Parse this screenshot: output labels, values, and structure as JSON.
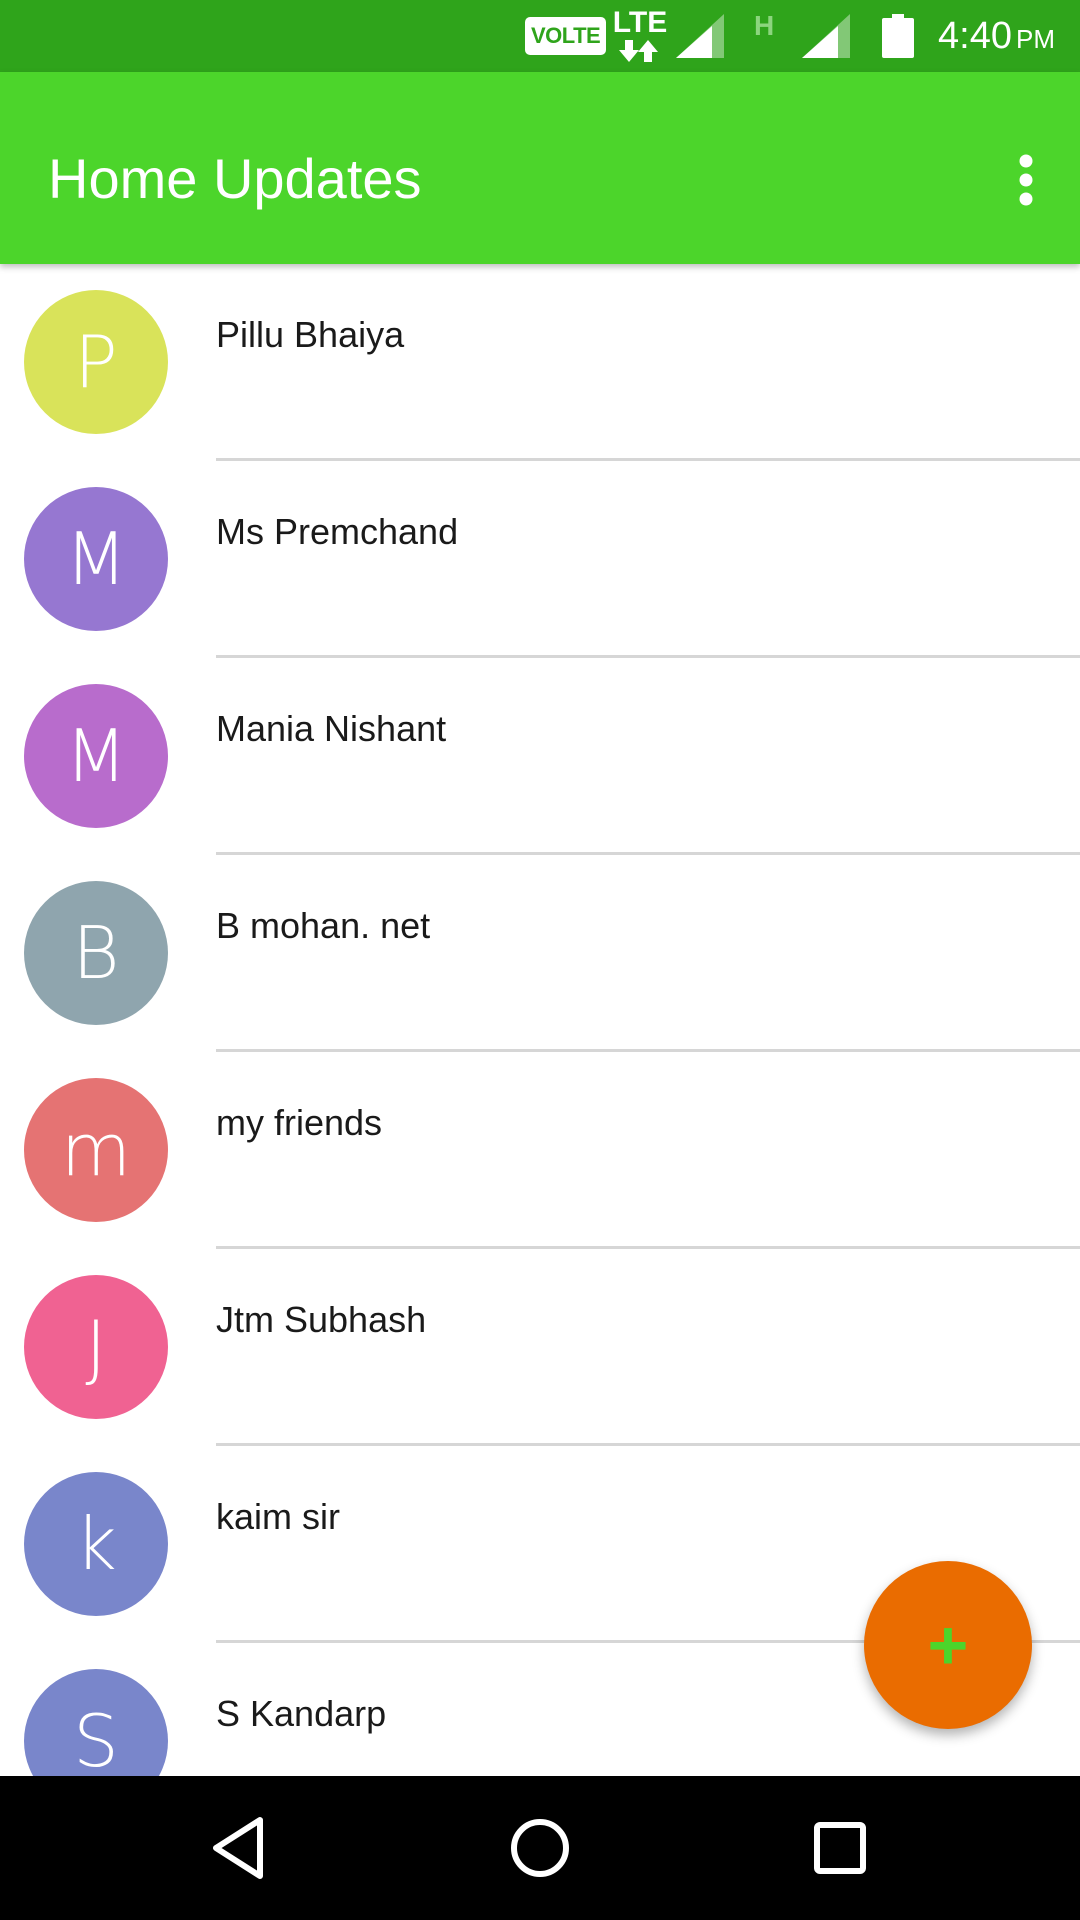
{
  "status_bar": {
    "volte": "VOLTE",
    "lte": "LTE",
    "h_indicator": "H",
    "time": "4:40",
    "ampm": "PM",
    "icons": [
      "lte-arrows-icon",
      "signal-icon",
      "signal-icon",
      "battery-icon"
    ]
  },
  "app_bar": {
    "title": "Home Updates",
    "overflow_icon": "more-vert-icon"
  },
  "contacts": [
    {
      "initial": "P",
      "name": "Pillu Bhaiya",
      "color": "#d9e35a"
    },
    {
      "initial": "M",
      "name": "Ms Premchand",
      "color": "#9677d1"
    },
    {
      "initial": "M",
      "name": "Mania Nishant",
      "color": "#b86ccc"
    },
    {
      "initial": "B",
      "name": "B mohan. net",
      "color": "#8fa5ae"
    },
    {
      "initial": "m",
      "name": "my friends",
      "color": "#e57373"
    },
    {
      "initial": "J",
      "name": "Jtm Subhash",
      "color": "#f06292"
    },
    {
      "initial": "k",
      "name": "kaim sir",
      "color": "#7986cb"
    },
    {
      "initial": "S",
      "name": "S Kandarp",
      "color": "#7986cb"
    }
  ],
  "fab": {
    "label": "+",
    "icon": "add-icon",
    "color": "#ea6c00"
  },
  "nav_bar": {
    "icons": [
      "back-icon",
      "home-icon",
      "recents-icon"
    ]
  },
  "colors": {
    "status_bar": "#2fa41b",
    "app_bar": "#4cd52b",
    "fab": "#ea6c00"
  }
}
